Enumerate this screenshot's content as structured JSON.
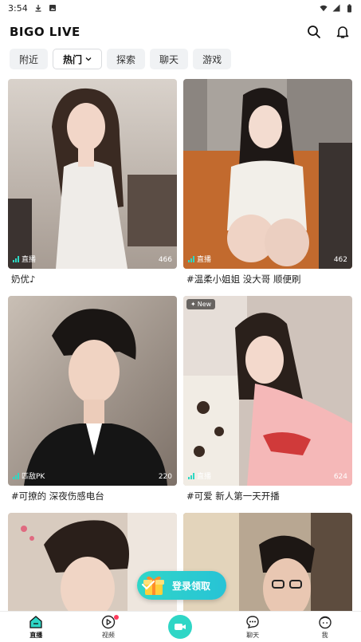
{
  "status": {
    "time": "3:54"
  },
  "header": {
    "brand": "BIGO LIVE"
  },
  "tabs": [
    {
      "label": "附近"
    },
    {
      "label": "热门"
    },
    {
      "label": "探索"
    },
    {
      "label": "聊天"
    },
    {
      "label": "游戏"
    }
  ],
  "cards": [
    {
      "badge": "直播",
      "viewers": "466",
      "caption": "奶优♪"
    },
    {
      "badge": "直播",
      "viewers": "462",
      "caption": "#温柔小姐姐 没大哥 顺便刷"
    },
    {
      "badge": "匹敌PK",
      "viewers": "220",
      "caption": "#可撩的 深夜伤感电台"
    },
    {
      "badge": "直播",
      "viewers": "624",
      "caption": "#可爱 新人第一天开播",
      "tag": "New"
    },
    {
      "caption": ""
    },
    {
      "caption": ""
    }
  ],
  "promo": {
    "label": "登录领取"
  },
  "nav": [
    {
      "label": "直播"
    },
    {
      "label": "视频"
    },
    {
      "label": ""
    },
    {
      "label": "聊天"
    },
    {
      "label": "我"
    }
  ],
  "colors": {
    "accent": "#2fd6c6",
    "badge_bar": "#2ed8c3",
    "notify": "#ff3b5c"
  }
}
